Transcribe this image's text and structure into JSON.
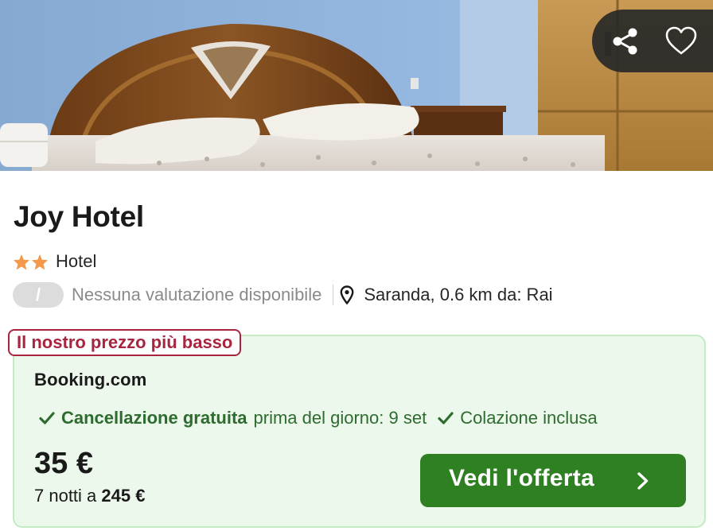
{
  "actions": {
    "share_icon": "share-icon",
    "favorite_icon": "heart-outline-icon"
  },
  "hotel": {
    "name": "Joy Hotel",
    "star_rating": 2,
    "type": "Hotel",
    "rating_badge": "/",
    "rating_text": "Nessuna valutazione disponibile",
    "location": "Saranda, 0.6 km da: Rai"
  },
  "deal": {
    "badge": "Il nostro prezzo più basso",
    "provider": "Booking.com",
    "features": [
      {
        "strong": "Cancellazione gratuita",
        "text": "prima del giorno: 9 set"
      },
      {
        "strong": "",
        "text": "Colazione inclusa"
      }
    ],
    "price": "35 €",
    "nights_prefix": "7 notti a ",
    "total": "245 €",
    "cta_label": "Vedi l'offerta"
  },
  "colors": {
    "star": "#f2994a",
    "badge": "#a8253f",
    "card_bg": "#ebf8eb",
    "card_border": "#c4ebc4",
    "feature_green": "#2e6b2e",
    "cta_bg": "#2f8022"
  }
}
